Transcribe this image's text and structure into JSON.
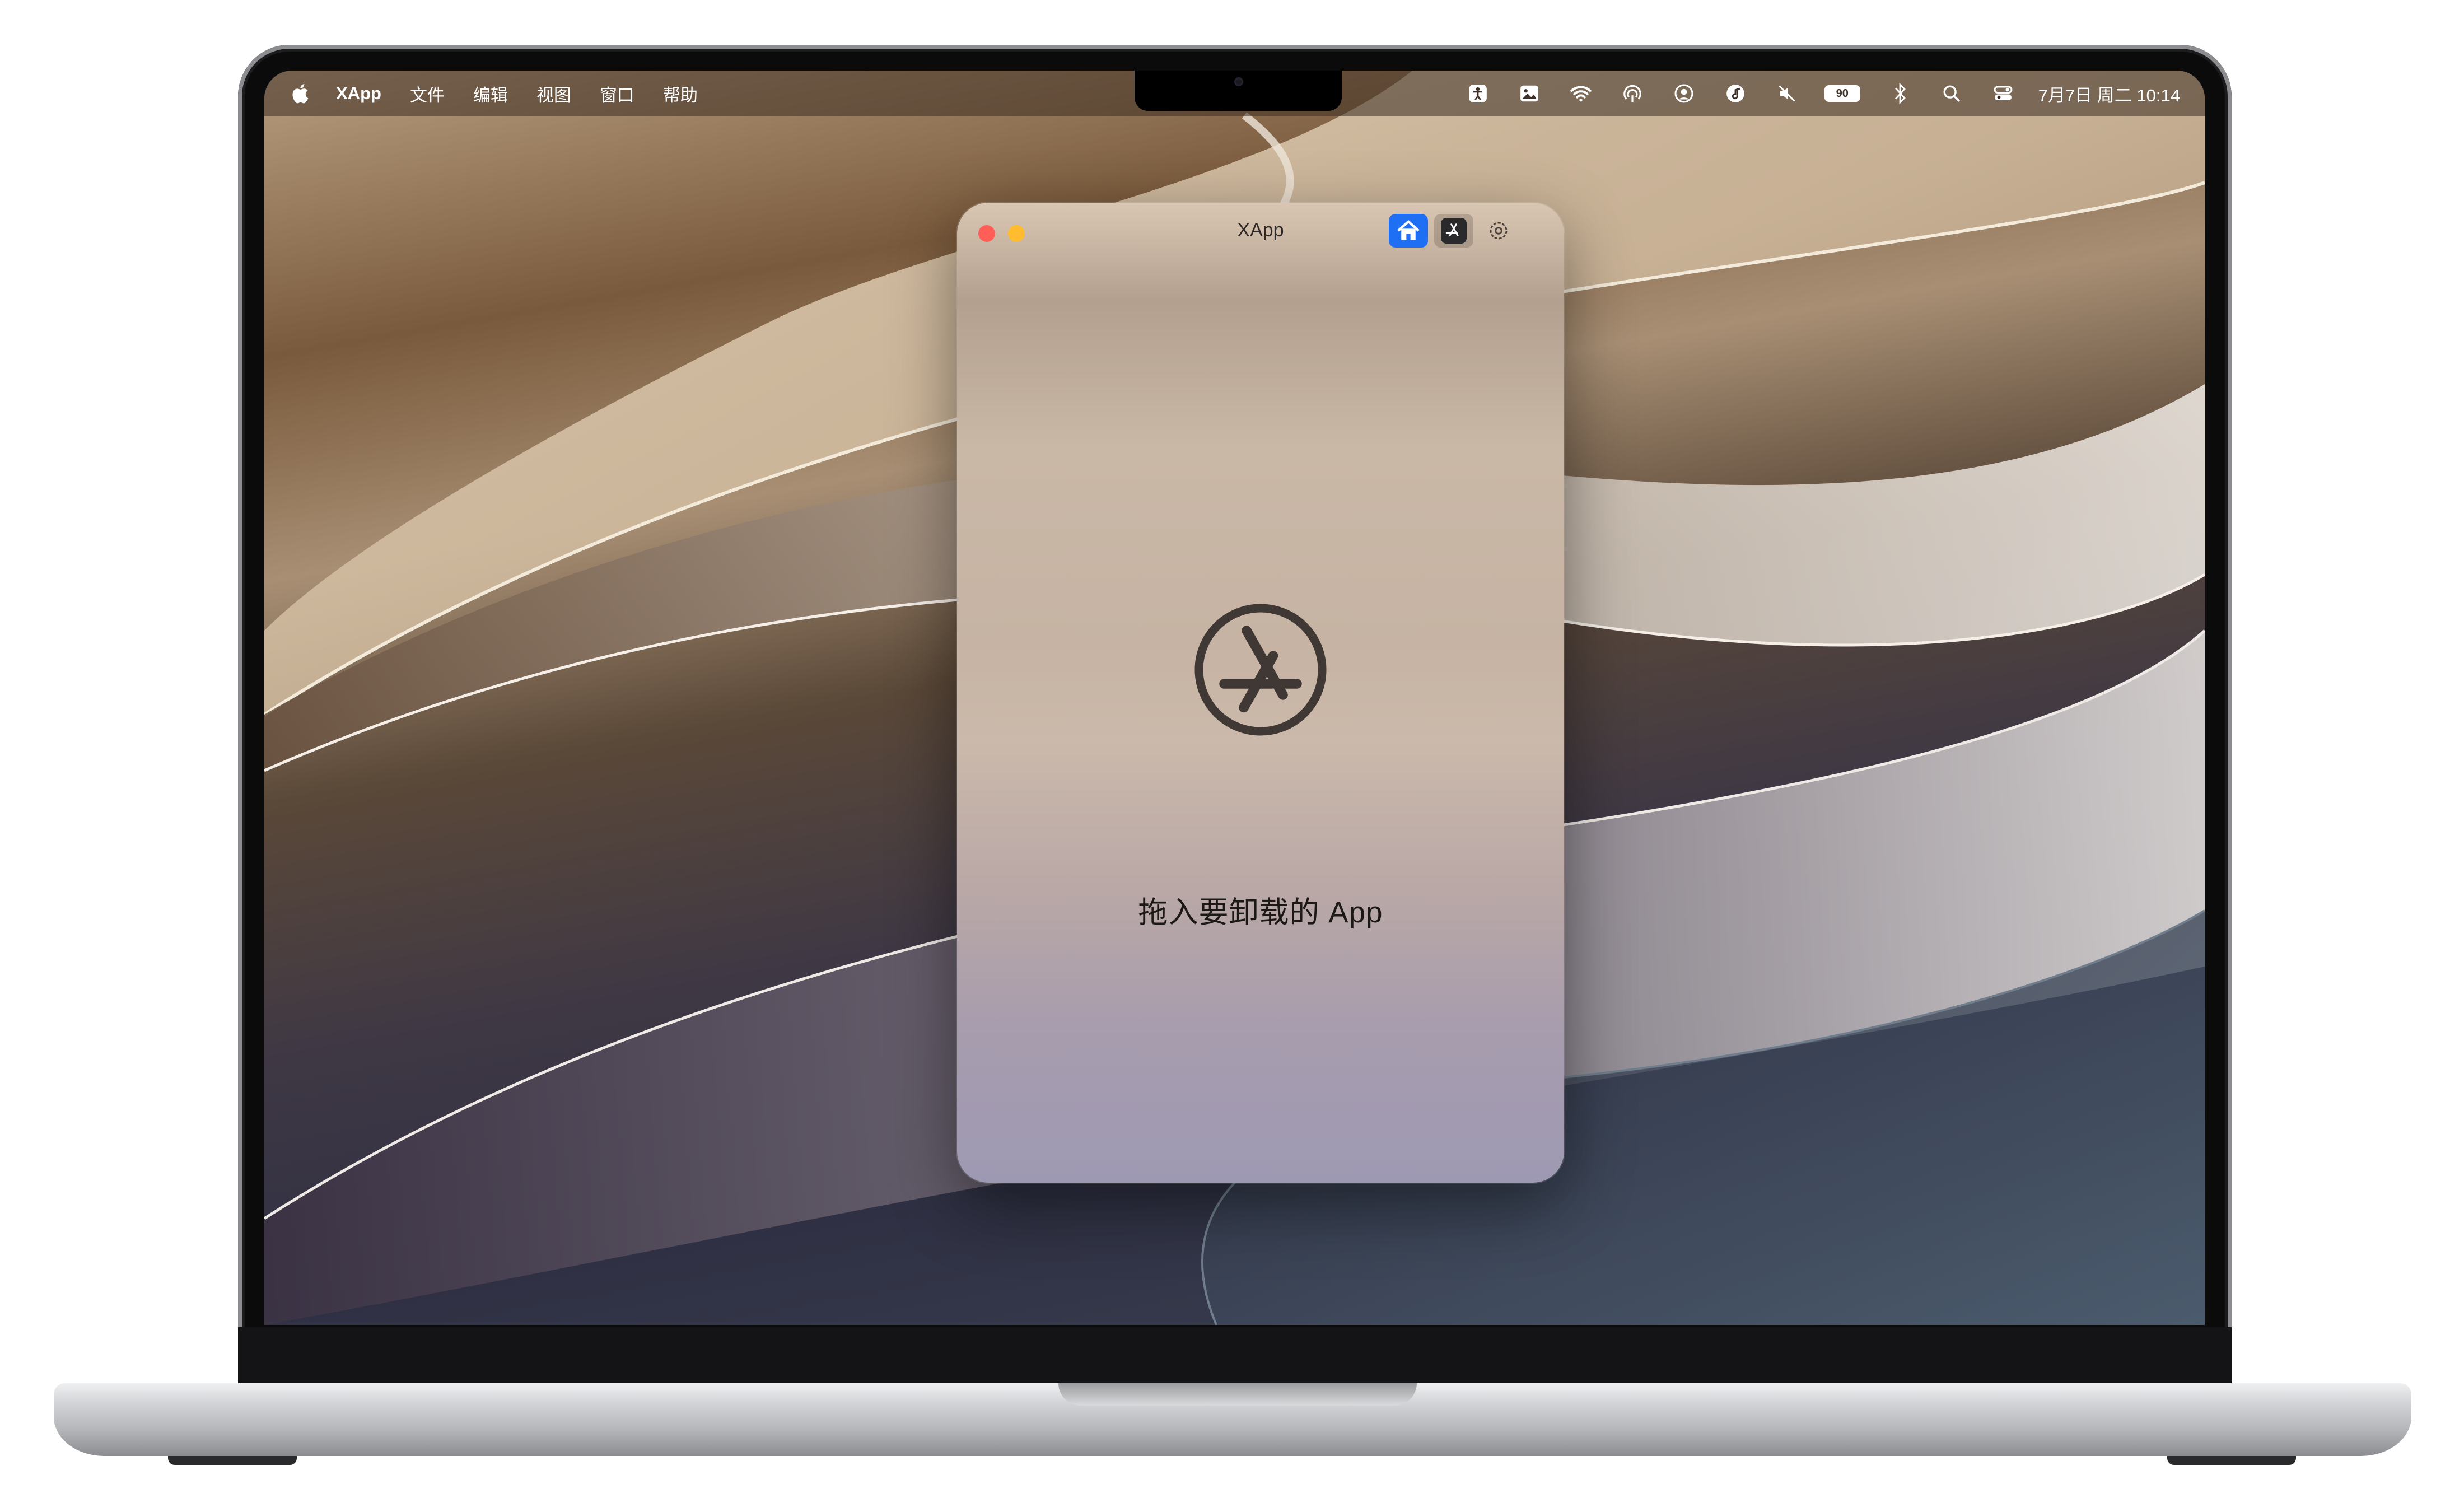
{
  "menubar": {
    "app_name": "XApp",
    "items": [
      "文件",
      "编辑",
      "视图",
      "窗口",
      "帮助"
    ],
    "status_icons": [
      "accessibility-icon",
      "image-icon",
      "wifi-icon",
      "airdrop-icon",
      "user-icon",
      "music-icon",
      "mute-icon"
    ],
    "battery": "90",
    "clock": "7月7日 周二  10:14"
  },
  "window": {
    "title": "XApp",
    "toolbar": {
      "home": "home-icon",
      "store": "app-store-icon",
      "settings": "gear-icon",
      "home_color": "#1f6ff4"
    },
    "drop_zone": {
      "icon": "app-store-icon",
      "label": "拖入要卸载的 App"
    }
  },
  "colors": {
    "close": "#ff5f57",
    "minimize": "#febc2e",
    "accent": "#1f6ff4"
  }
}
